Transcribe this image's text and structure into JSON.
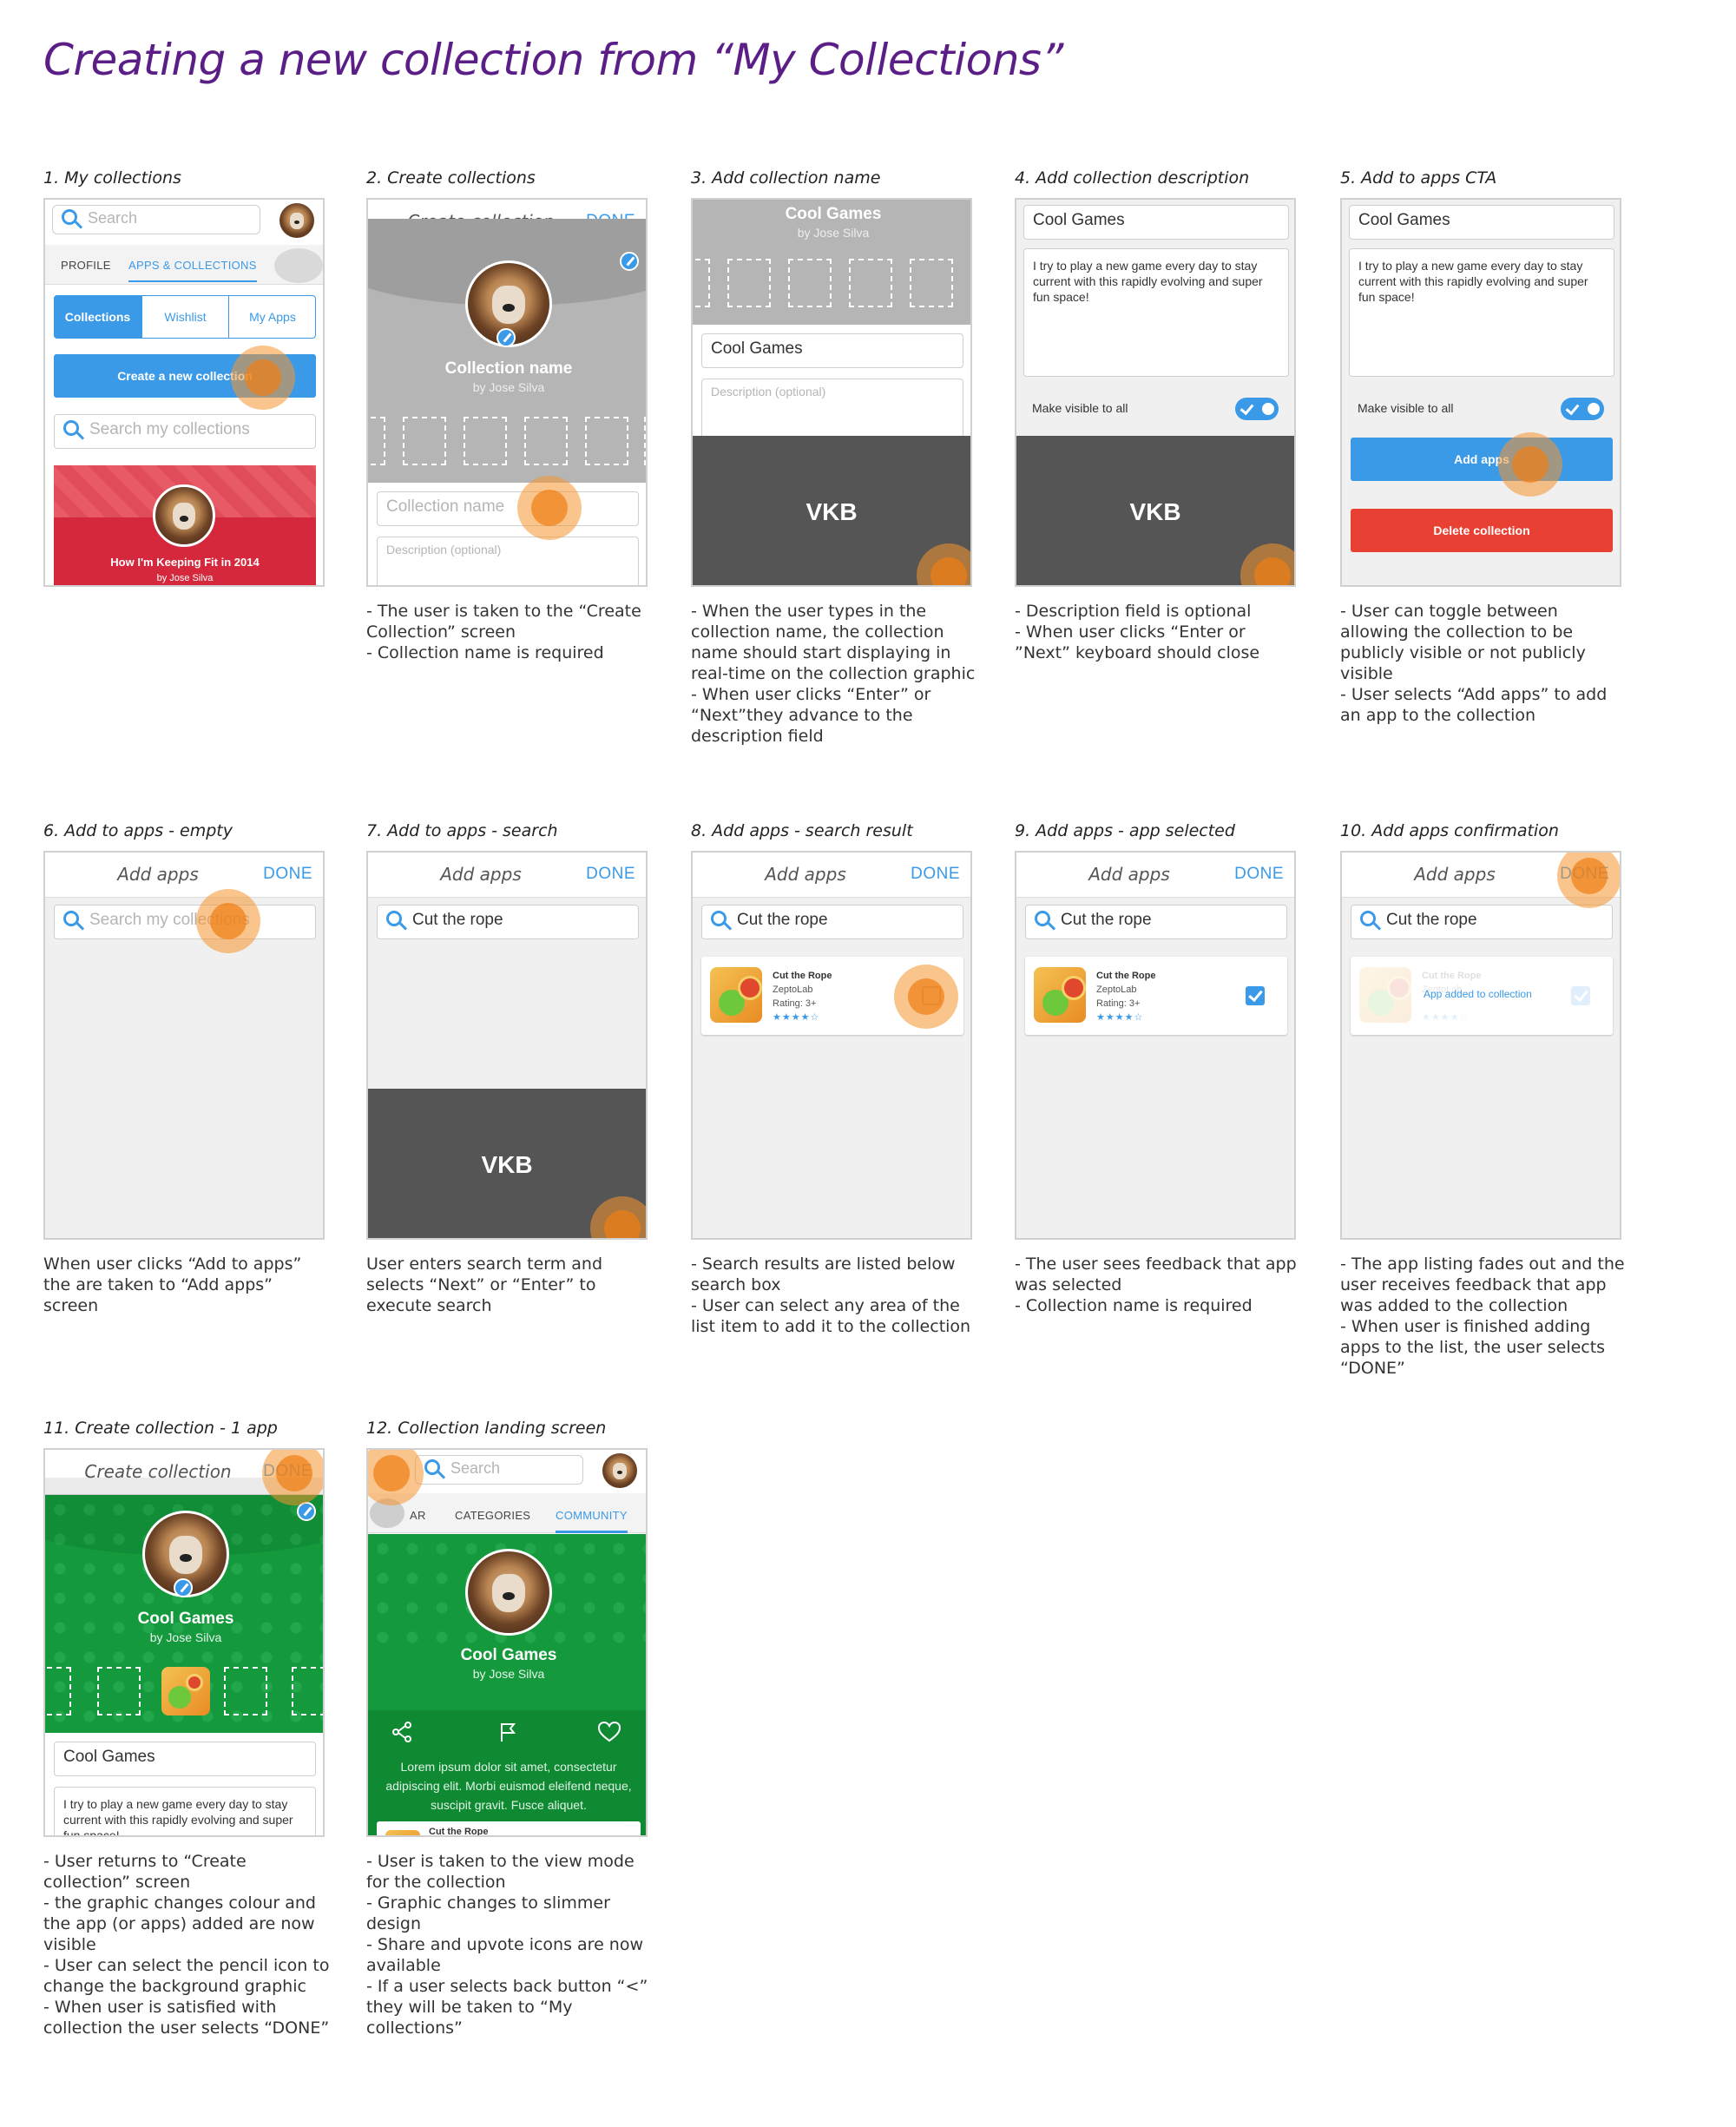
{
  "page_title": "Creating a new collection from “My Collections”",
  "colors": {
    "accent_blue": "#3a9ae8",
    "highlight_orange": "#f5962d",
    "title_purple": "#5b1e86",
    "collection_red": "#d6283c",
    "collection_green": "#149a3c",
    "delete_red": "#e84133"
  },
  "common": {
    "add_apps_title": "Add apps",
    "create_collection_title": "Create collection",
    "done": "DONE",
    "collection_name_ph": "Collection name",
    "description_ph": "Description (optional)",
    "author": "by Jose Silva",
    "cool_games": "Cool Games",
    "description_text": "I try to play a new game every day to stay current with this rapidly evolving and super fun space!",
    "vkb": "VKB",
    "make_visible": "Make visible to all",
    "search_term": "Cut the rope",
    "search_my_collections": "Search my collections",
    "search": "Search",
    "app": {
      "name": "Cut the Rope",
      "dev": "ZeptoLab",
      "rating": "Rating: 3+",
      "stars": "★★★★☆",
      "added": "App added to collection"
    }
  },
  "s1": {
    "title": "1. My collections",
    "tab_profile": "PROFILE",
    "tab_apps": "APPS & COLLECTIONS",
    "seg": [
      "Collections",
      "Wishlist",
      "My Apps"
    ],
    "create_btn": "Create a new collection",
    "card_title": "How I'm Keeping Fit in 2014"
  },
  "s2": {
    "title": "2. Create collections",
    "notes": [
      "- The user is taken to the “Create Collection” screen",
      "- Collection name is required"
    ]
  },
  "s3": {
    "title": "3. Add collection name",
    "notes": [
      "- When the user types in the collection name, the collection name should start displaying in real-time on the collection graphic",
      "- When user clicks “Enter” or “Next”they advance to the description field"
    ]
  },
  "s4": {
    "title": "4. Add collection description",
    "notes": [
      "- Description field is optional",
      "- When user clicks “Enter or ”Next” keyboard should close"
    ]
  },
  "s5": {
    "title": "5. Add to apps CTA",
    "add_apps_btn": "Add apps",
    "delete_btn": "Delete collection",
    "notes": [
      "- User can toggle between allowing the collection to be publicly visible or not publicly visible",
      "- User selects “Add apps” to add an app to the collection"
    ]
  },
  "s6": {
    "title": "6. Add to apps - empty",
    "notes": [
      "When user clicks “Add to apps” the are taken to “Add apps” screen"
    ]
  },
  "s7": {
    "title": "7. Add to apps - search",
    "notes": [
      "User enters search term and selects “Next” or “Enter” to execute search"
    ]
  },
  "s8": {
    "title": "8. Add apps - search result",
    "notes": [
      "- Search results are listed below search box",
      "- User can select any area of the list item to add it to the collection"
    ]
  },
  "s9": {
    "title": "9. Add apps - app selected",
    "notes": [
      "- The user sees feedback that app was selected",
      "- Collection name is required"
    ]
  },
  "s10": {
    "title": "10. Add apps confirmation",
    "notes": [
      "- The app listing fades out and the user receives feedback that app was added to the collection",
      "- When user is finished adding apps to the list, the user selects “DONE”"
    ]
  },
  "s11": {
    "title": "11. Create collection - 1 app",
    "notes": [
      "- User returns to “Create collection” screen",
      "- the graphic changes colour and the app (or apps) added are now visible",
      "- User can select the pencil icon to change the background graphic",
      "- When user is satisfied with collection the user selects “DONE”"
    ]
  },
  "s12": {
    "title": "12. Collection landing screen",
    "tab_ar": "AR",
    "tab_categories": "CATEGORIES",
    "tab_community": "COMMUNITY",
    "lorem": "Lorem ipsum dolor sit amet, consectetur adipiscing elit. Morbi euismod eleifend neque, suscipit gravit. Fusce aliquet.",
    "notes": [
      "- User is taken to the view mode for the collection",
      "- Graphic changes to slimmer design",
      "- Share and upvote icons are now available",
      "- If a user selects back button “<” they will be taken to “My collections”"
    ]
  }
}
